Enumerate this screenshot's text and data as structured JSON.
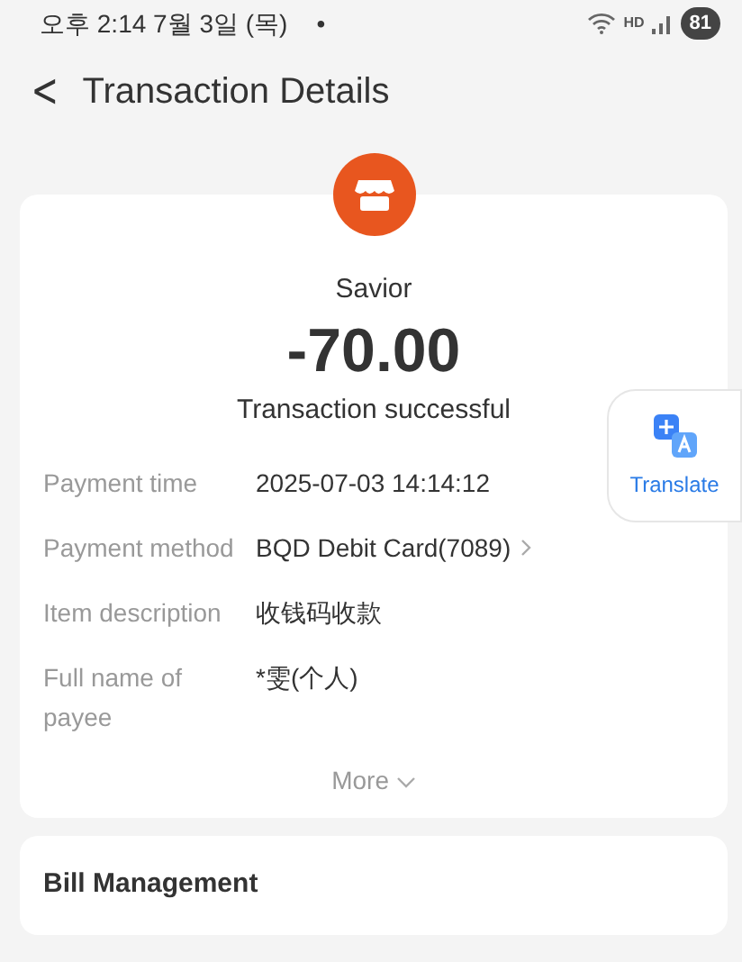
{
  "status_bar": {
    "time": "오후 2:14  7월 3일 (목)",
    "dot": "•",
    "network": "HD",
    "battery": "81"
  },
  "header": {
    "back": "<",
    "title": "Transaction Details"
  },
  "summary": {
    "merchant": "Savior",
    "amount": "-70.00",
    "status": "Transaction successful"
  },
  "translate": {
    "label": "Translate"
  },
  "details": [
    {
      "label": "Payment time",
      "value": "2025-07-03 14:14:12",
      "link": false
    },
    {
      "label": "Payment method",
      "value": "BQD Debit Card(7089)",
      "link": true
    },
    {
      "label": "Item description",
      "value": "收钱码收款",
      "link": false
    },
    {
      "label": "Full name of payee",
      "value": "*雯(个人)",
      "link": false
    }
  ],
  "more": {
    "label": "More"
  },
  "bill_management": {
    "title": "Bill Management"
  }
}
